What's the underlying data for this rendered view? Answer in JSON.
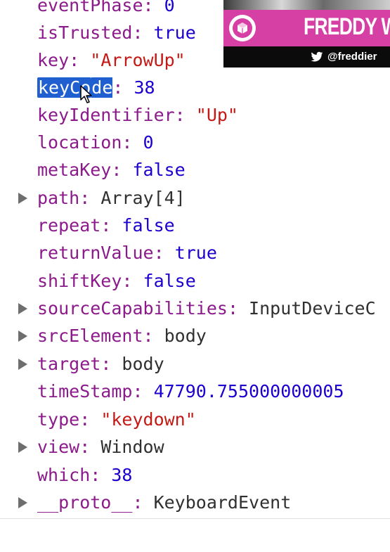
{
  "console": {
    "rows": [
      {
        "key": "eventPhase",
        "value": "0",
        "type": "num",
        "expandable": false
      },
      {
        "key": "isTrusted",
        "value": "true",
        "type": "bool",
        "expandable": false
      },
      {
        "key": "key",
        "value": "\"ArrowUp\"",
        "type": "str",
        "expandable": false
      },
      {
        "key": "keyCode",
        "value": "38",
        "type": "num",
        "expandable": false,
        "selected_part": "keyCo",
        "rest_part": "de"
      },
      {
        "key": "keyIdentifier",
        "value": "\"Up\"",
        "type": "str",
        "expandable": false
      },
      {
        "key": "location",
        "value": "0",
        "type": "num",
        "expandable": false
      },
      {
        "key": "metaKey",
        "value": "false",
        "type": "bool",
        "expandable": false
      },
      {
        "key": "path",
        "value": "Array[4]",
        "type": "obj",
        "expandable": true
      },
      {
        "key": "repeat",
        "value": "false",
        "type": "bool",
        "expandable": false
      },
      {
        "key": "returnValue",
        "value": "true",
        "type": "bool",
        "expandable": false
      },
      {
        "key": "shiftKey",
        "value": "false",
        "type": "bool",
        "expandable": false
      },
      {
        "key": "sourceCapabilities",
        "value": "InputDeviceC",
        "type": "obj",
        "expandable": true
      },
      {
        "key": "srcElement",
        "value": "body",
        "type": "obj",
        "expandable": true
      },
      {
        "key": "target",
        "value": "body",
        "type": "obj",
        "expandable": true
      },
      {
        "key": "timeStamp",
        "value": "47790.755000000005",
        "type": "num",
        "expandable": false
      },
      {
        "key": "type",
        "value": "\"keydown\"",
        "type": "str",
        "expandable": false
      },
      {
        "key": "view",
        "value": "Window",
        "type": "obj",
        "expandable": true
      },
      {
        "key": "which",
        "value": "38",
        "type": "num",
        "expandable": false
      },
      {
        "key": "__proto__",
        "value": "KeyboardEvent",
        "type": "obj",
        "expandable": true
      }
    ]
  },
  "overlay": {
    "name": "FREDDY W",
    "handle": "@freddier",
    "band_color": "#d63fa3"
  }
}
